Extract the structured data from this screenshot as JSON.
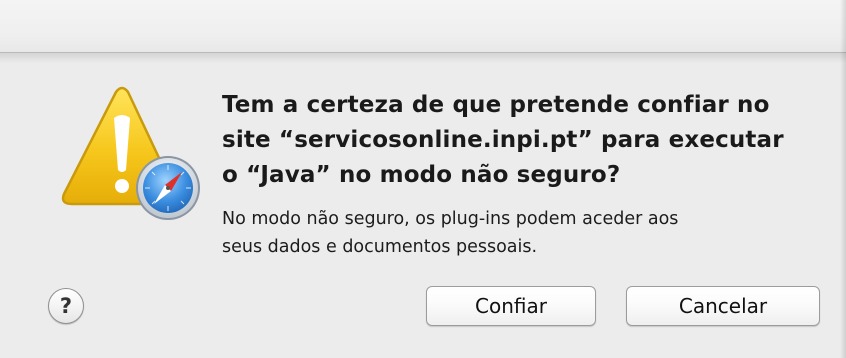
{
  "dialog": {
    "icon": "warning-triangle-with-safari-compass-icon",
    "title": "Tem a certeza de que pretende confiar no\nsite “servicosonline.inpi.pt” para executar\no “Java” no modo não seguro?",
    "message": "No modo não seguro, os plug-ins podem aceder aos\nseus dados e documentos pessoais.",
    "help_label": "?",
    "buttons": {
      "confirm": "Confiar",
      "cancel": "Cancelar"
    }
  },
  "colors": {
    "warning_yellow": "#f3c51a",
    "warning_border": "#c99a0c",
    "compass_blue": "#2f7fd6",
    "dialog_background": "#ececec"
  }
}
